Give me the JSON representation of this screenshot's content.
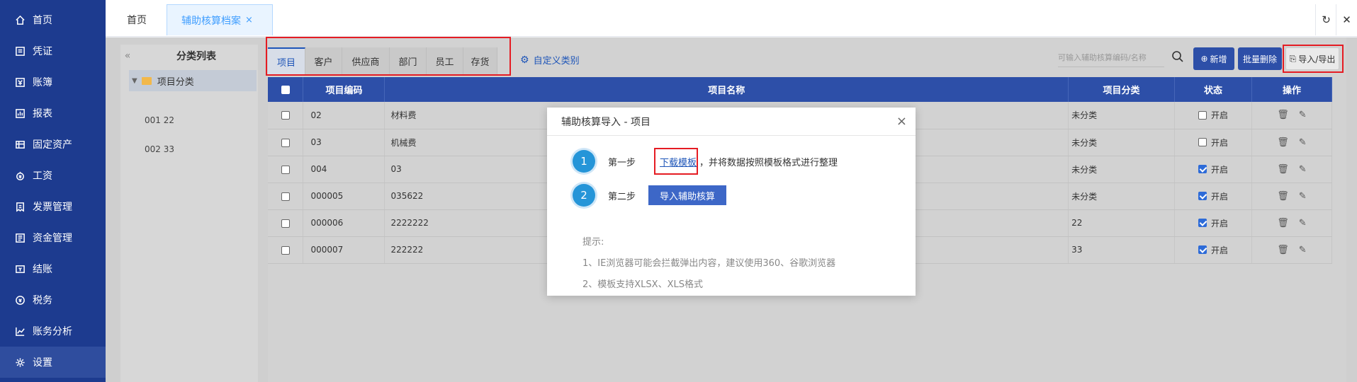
{
  "sidebar": {
    "items": [
      {
        "label": "首页",
        "icon": "home-icon"
      },
      {
        "label": "凭证",
        "icon": "voucher-icon"
      },
      {
        "label": "账簿",
        "icon": "ledger-icon"
      },
      {
        "label": "报表",
        "icon": "report-icon"
      },
      {
        "label": "固定资产",
        "icon": "asset-icon"
      },
      {
        "label": "工资",
        "icon": "salary-icon"
      },
      {
        "label": "发票管理",
        "icon": "invoice-icon"
      },
      {
        "label": "资金管理",
        "icon": "fund-icon"
      },
      {
        "label": "结账",
        "icon": "closing-icon"
      },
      {
        "label": "税务",
        "icon": "tax-icon"
      },
      {
        "label": "账务分析",
        "icon": "analysis-icon"
      },
      {
        "label": "设置",
        "icon": "settings-icon"
      }
    ]
  },
  "topbar": {
    "home_tab": "首页",
    "active_tab": "辅助核算档案",
    "close_glyph": "×",
    "refresh_glyph": "↻",
    "close_all_glyph": "✕"
  },
  "category": {
    "collapse_glyph": "«",
    "title": "分类列表",
    "root": "项目分类",
    "children": [
      "001 22",
      "002 33"
    ]
  },
  "subtabs": [
    "项目",
    "客户",
    "供应商",
    "部门",
    "员工",
    "存货"
  ],
  "custom_category": "自定义类别",
  "search": {
    "placeholder": "可输入辅助核算编码/名称"
  },
  "toolbar": {
    "add": "新增",
    "batch_delete": "批量删除",
    "import_export": "导入/导出"
  },
  "table": {
    "headers": [
      "项目编码",
      "项目名称",
      "项目分类",
      "状态",
      "操作"
    ],
    "rows": [
      {
        "code": "02",
        "name": "材料费",
        "category": "未分类",
        "status": "开启",
        "on": false
      },
      {
        "code": "03",
        "name": "机械费",
        "category": "未分类",
        "status": "开启",
        "on": false
      },
      {
        "code": "004",
        "name": "03",
        "category": "未分类",
        "status": "开启",
        "on": true
      },
      {
        "code": "000005",
        "name": "035622",
        "category": "未分类",
        "status": "开启",
        "on": true
      },
      {
        "code": "000006",
        "name": "2222222",
        "category": "22",
        "status": "开启",
        "on": true
      },
      {
        "code": "000007",
        "name": "222222",
        "category": "33",
        "status": "开启",
        "on": true
      }
    ]
  },
  "modal": {
    "title": "辅助核算导入 - 项目",
    "close": "×",
    "step1_num": "1",
    "step1_label": "第一步",
    "step1_link": "下载模板",
    "step1_text": "，并将数据按照模板格式进行整理",
    "step2_num": "2",
    "step2_label": "第二步",
    "step2_button": "导入辅助核算",
    "tips_title": "提示:",
    "tip1": "1、IE浏览器可能会拦截弹出内容，建议使用360、谷歌浏览器",
    "tip2": "2、模板支持XLSX、XLS格式"
  },
  "colors": {
    "sidebar": "#1d3b8f",
    "header": "#2d4fa8",
    "accent": "#1e55b8",
    "highlight": "#e51c23"
  }
}
